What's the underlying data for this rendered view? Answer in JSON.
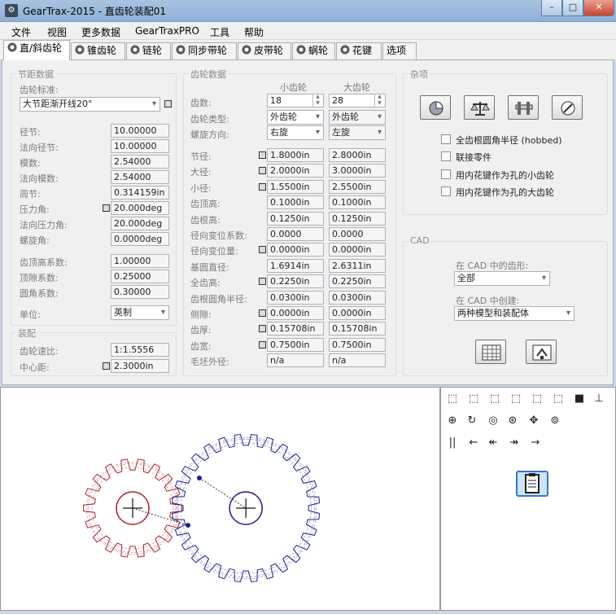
{
  "window": {
    "title": "GearTrax-2015 - 直齿轮装配01",
    "min": "–",
    "max": "□",
    "close": "✕"
  },
  "menu": [
    "文件",
    "视图",
    "更多数据",
    "GearTraxPRO",
    "工具",
    "帮助"
  ],
  "tabs": [
    "直/斜齿轮",
    "锥齿轮",
    "链轮",
    "同步带轮",
    "皮带轮",
    "蜗轮",
    "花键",
    "选项"
  ],
  "pitch": {
    "group_title": "节距数据",
    "standard_label": "齿轮标准:",
    "standard_value": "大节距渐开线20°",
    "rows": [
      {
        "label": "径节:",
        "value": "10.00000"
      },
      {
        "label": "法向径节:",
        "value": "10.00000"
      },
      {
        "label": "模数:",
        "value": "2.54000"
      },
      {
        "label": "法向模数:",
        "value": "2.54000"
      },
      {
        "label": "周节:",
        "value": "0.314159in"
      },
      {
        "label": "压力角:",
        "value": "20.000deg"
      },
      {
        "label": "法向压力角:",
        "value": "20.000deg"
      },
      {
        "label": "螺旋角:",
        "value": "0.0000deg"
      }
    ],
    "rows2": [
      {
        "label": "齿顶高系数:",
        "value": "1.00000"
      },
      {
        "label": "顶隙系数:",
        "value": "0.25000"
      },
      {
        "label": "圆角系数:",
        "value": "0.30000"
      }
    ],
    "unit_label": "单位:",
    "unit_value": "英制"
  },
  "assembly": {
    "group_title": "装配",
    "ratio_label": "齿轮速比:",
    "ratio_value": "1:1.5556",
    "center_label": "中心距:",
    "center_value": "2.3000in"
  },
  "gear": {
    "group_title": "齿轮数据",
    "col_small": "小齿轮",
    "col_large": "大齿轮",
    "teeth_label": "齿数:",
    "teeth_small": "18",
    "teeth_large": "28",
    "type_label": "齿轮类型:",
    "type_small": "外齿轮",
    "type_large": "外齿轮",
    "helix_label": "螺旋方向:",
    "helix_small": "右旋",
    "helix_large": "左旋",
    "rows": [
      {
        "label": "节径:",
        "small": "1.8000in",
        "large": "2.8000in"
      },
      {
        "label": "大径:",
        "small": "2.0000in",
        "large": "3.0000in"
      },
      {
        "label": "小径:",
        "small": "1.5500in",
        "large": "2.5500in"
      },
      {
        "label": "齿顶高:",
        "small": "0.1000in",
        "large": "0.1000in"
      },
      {
        "label": "齿根高:",
        "small": "0.1250in",
        "large": "0.1250in"
      },
      {
        "label": "径向变位系数:",
        "small": "0.0000",
        "large": "0.0000"
      },
      {
        "label": "径向变位量:",
        "small": "0.0000in",
        "large": "0.0000in"
      },
      {
        "label": "基圆直径:",
        "small": "1.6914in",
        "large": "2.6311in"
      },
      {
        "label": "全齿高:",
        "small": "0.2250in",
        "large": "0.2250in"
      },
      {
        "label": "齿根圆角半径:",
        "small": "0.0300in",
        "large": "0.0300in"
      },
      {
        "label": "侧隙:",
        "small": "0.0000in",
        "large": "0.0000in"
      },
      {
        "label": "齿厚:",
        "small": "0.15708in",
        "large": "0.15708in"
      },
      {
        "label": "齿宽:",
        "small": "0.7500in",
        "large": "0.7500in"
      },
      {
        "label": "毛坯外径:",
        "small": "n/a",
        "large": "n/a"
      }
    ]
  },
  "misc": {
    "group_title": "杂项",
    "checks": [
      "全齿根圆角半径 (hobbed)",
      "联接零件",
      "用内花键作为孔的小齿轮",
      "用内花键作为孔的大齿轮"
    ]
  },
  "cad": {
    "group_title": "CAD",
    "shape_label": "在 CAD 中的齿形:",
    "shape_value": "全部",
    "create_label": "在 CAD 中创建:",
    "create_value": "两种模型和装配体"
  },
  "toolbar": {
    "row3": [
      "||",
      "←",
      "↞",
      "↠",
      "→"
    ]
  },
  "colors": {
    "pinion": "#b0202a",
    "gear": "#1b1f8c"
  }
}
